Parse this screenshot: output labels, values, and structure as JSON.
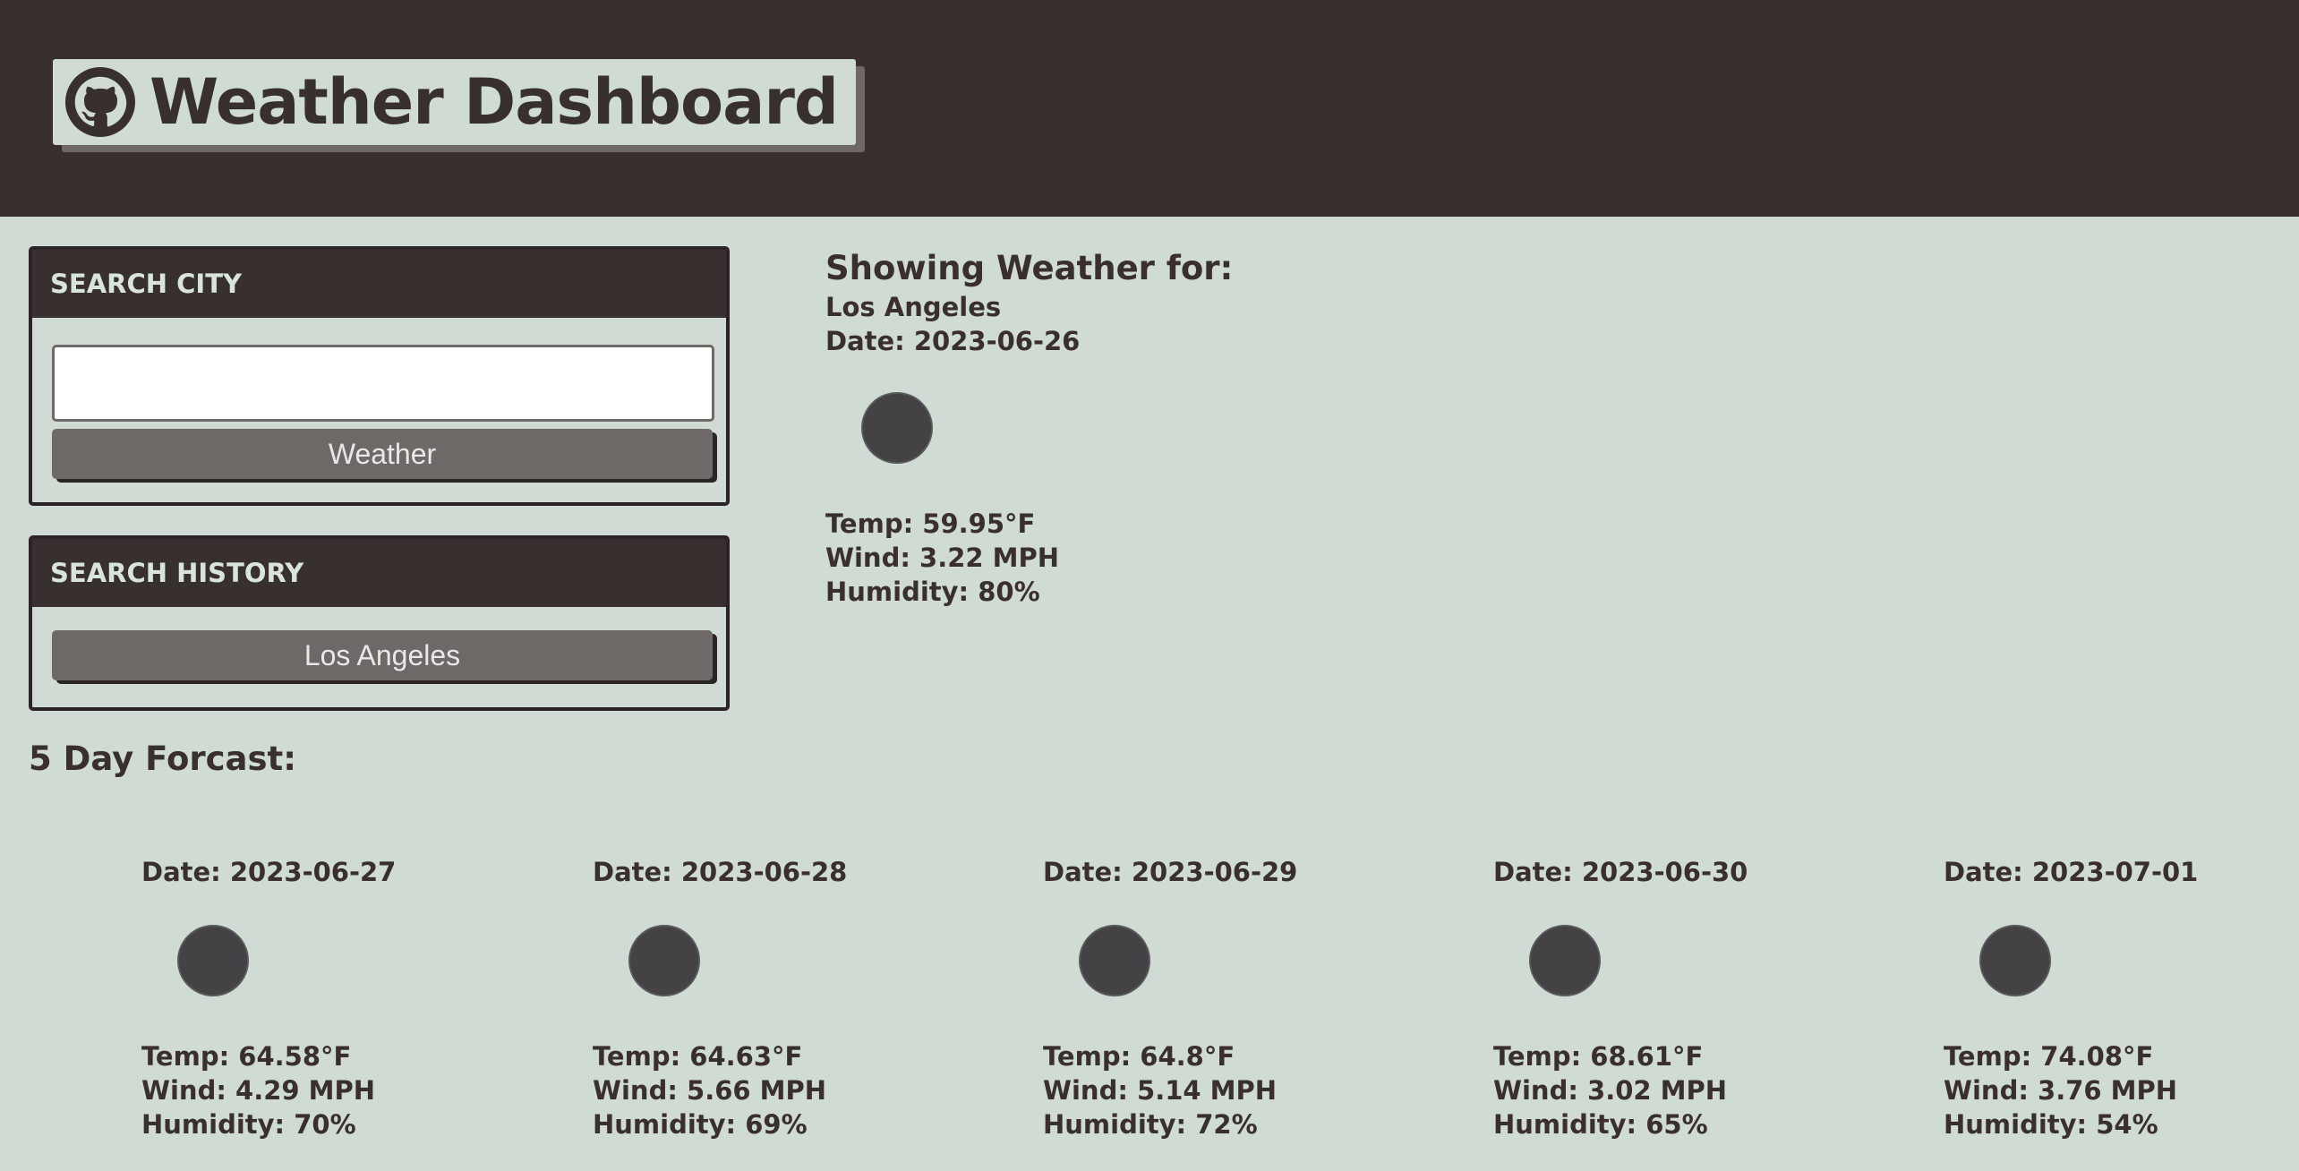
{
  "header": {
    "title": "Weather Dashboard",
    "icon": "github-icon"
  },
  "search": {
    "heading": "SEARCH CITY",
    "input_value": "",
    "button_label": "Weather"
  },
  "history": {
    "heading": "SEARCH HISTORY",
    "items": [
      "Los Angeles"
    ]
  },
  "current": {
    "label": "Showing Weather for:",
    "city": "Los Angeles",
    "date": "Date: 2023-06-26",
    "temp": "Temp: 59.95°F",
    "wind": "Wind: 3.22 MPH",
    "humidity": "Humidity: 80%"
  },
  "forecast": {
    "title": "5 Day Forcast:",
    "days": [
      {
        "date": "Date: 2023-06-27",
        "temp": "Temp: 64.58°F",
        "wind": "Wind: 4.29 MPH",
        "humidity": "Humidity: 70%"
      },
      {
        "date": "Date: 2023-06-28",
        "temp": "Temp: 64.63°F",
        "wind": "Wind: 5.66 MPH",
        "humidity": "Humidity: 69%"
      },
      {
        "date": "Date: 2023-06-29",
        "temp": "Temp: 64.8°F",
        "wind": "Wind: 5.14 MPH",
        "humidity": "Humidity: 72%"
      },
      {
        "date": "Date: 2023-06-30",
        "temp": "Temp: 68.61°F",
        "wind": "Wind: 3.02 MPH",
        "humidity": "Humidity: 65%"
      },
      {
        "date": "Date: 2023-07-01",
        "temp": "Temp: 74.08°F",
        "wind": "Wind: 3.76 MPH",
        "humidity": "Humidity: 54%"
      }
    ]
  },
  "colors": {
    "header_bg": "#382f2f",
    "page_bg": "#cfdbd3",
    "button_bg": "#6e6866",
    "icon_placeholder": "#444244"
  }
}
